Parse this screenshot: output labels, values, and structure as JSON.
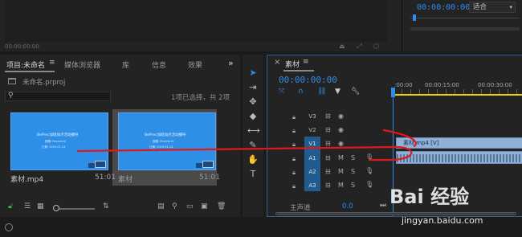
{
  "program_monitor": {
    "timecode": "00:00:00:00",
    "fit_label": "适合",
    "chevron": "▾"
  },
  "source_monitor": {
    "timecode": "00:00:00:00"
  },
  "project_panel": {
    "tabs": {
      "project": "项目:未命名",
      "menu": "≡",
      "media_browser": "媒体浏览器",
      "library": "库",
      "info": "信息",
      "effects": "效果",
      "more": "»"
    },
    "file_name": "未命名.prproj",
    "selection_info": "1项已选择，共 2项",
    "clips": [
      {
        "name": "素材.mp4",
        "duration": "51:01",
        "thumb_title": "BePrec加班加点活动播导",
        "thumb_line2": "报题: Recolia  IV",
        "thumb_line3": "日期: 2019.01.14"
      },
      {
        "name": "素材",
        "duration": "51:01",
        "thumb_title": "BePrec加班加点活动播导",
        "thumb_line2": "报题: Recolia  IV",
        "thumb_line3": "日期: 2019.01.14"
      }
    ]
  },
  "timeline": {
    "close": "×",
    "tab_label": "素材",
    "tab_menu": "≡",
    "timecode": "00:00:00:00",
    "ruler": [
      ":00:00",
      "00:00:15:00",
      "00:00:30:00"
    ],
    "tracks": [
      {
        "name": "V3",
        "type": "video"
      },
      {
        "name": "V2",
        "type": "video"
      },
      {
        "name": "V1",
        "type": "video"
      },
      {
        "name": "A1",
        "type": "audio"
      },
      {
        "name": "A2",
        "type": "audio"
      },
      {
        "name": "A3",
        "type": "audio"
      }
    ],
    "labels": {
      "m": "M",
      "s": "S"
    },
    "clip_v1_label": "素材.mp4 [V]",
    "master_label": "主声道",
    "master_value": "0.0"
  },
  "watermark": {
    "logo": "Bai 经验",
    "url": "jingyan.baidu.com"
  },
  "colors": {
    "accent_blue": "#2d8ceb",
    "clip_blue": "#8fb0d7",
    "ruler_yellow": "#e6d200",
    "annotation_red": "#e0181a"
  }
}
